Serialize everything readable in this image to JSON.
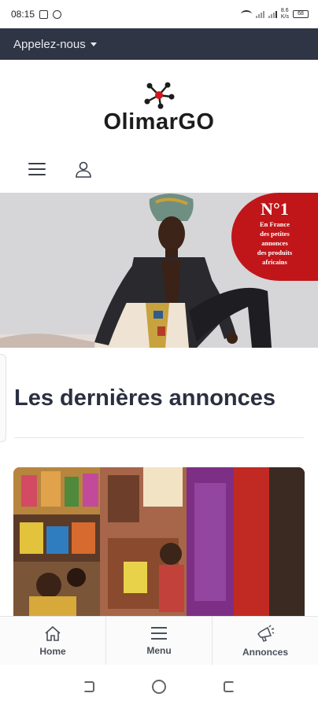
{
  "status_bar": {
    "time": "08:15",
    "net_speed": "8.6\nK/s",
    "battery": "68"
  },
  "topbar": {
    "contact_label": "Appelez-nous"
  },
  "logo": {
    "text": "OlimarGO"
  },
  "hero": {
    "badge_title": "N°1",
    "badge_lines": [
      "En France",
      "des petites",
      "annonces",
      "des produits",
      "africains"
    ]
  },
  "section": {
    "title": "Les dernières annonces"
  },
  "tabbar": {
    "items": [
      {
        "label": "Home",
        "icon": "home-icon"
      },
      {
        "label": "Menu",
        "icon": "menu-icon"
      },
      {
        "label": "Annonces",
        "icon": "megaphone-icon"
      }
    ]
  },
  "colors": {
    "topbar_bg": "#2f3544",
    "badge_red": "#c0161a",
    "logo_red": "#d4151b",
    "title_text": "#2b3040"
  }
}
